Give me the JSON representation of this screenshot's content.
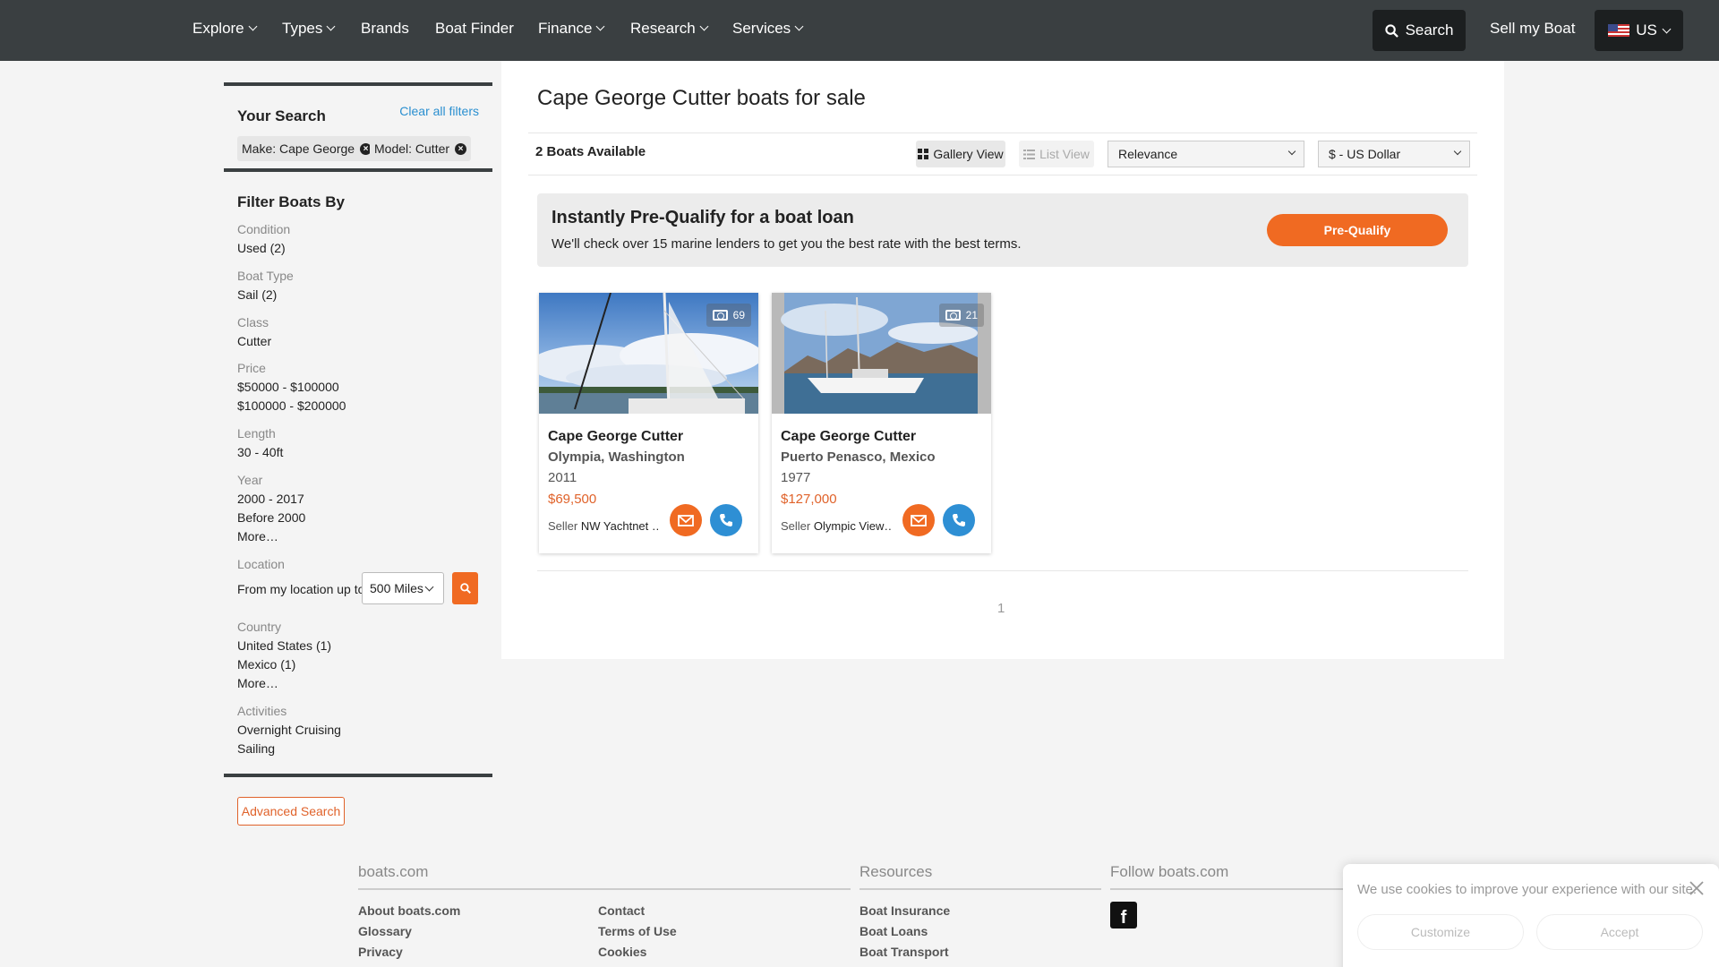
{
  "nav": {
    "items": [
      {
        "label": "Explore",
        "dropdown": true
      },
      {
        "label": "Types",
        "dropdown": true
      },
      {
        "label": "Brands",
        "dropdown": false
      },
      {
        "label": "Boat Finder",
        "dropdown": false
      },
      {
        "label": "Finance",
        "dropdown": true
      },
      {
        "label": "Research",
        "dropdown": true
      },
      {
        "label": "Services",
        "dropdown": true
      }
    ],
    "search_label": "Search",
    "sell_label": "Sell my Boat",
    "region_label": "US"
  },
  "your_search": {
    "title": "Your Search",
    "clear_label": "Clear all filters",
    "chips": [
      "Make: Cape George",
      "Model: Cutter"
    ]
  },
  "filters": {
    "title": "Filter Boats By",
    "condition_label": "Condition",
    "condition_values": [
      "Used (2)"
    ],
    "boat_type_label": "Boat Type",
    "boat_type_values": [
      "Sail (2)"
    ],
    "class_label": "Class",
    "class_values": [
      "Cutter"
    ],
    "price_label": "Price",
    "price_values": [
      "$50000 - $100000",
      "$100000 - $200000"
    ],
    "length_label": "Length",
    "length_values": [
      "30 - 40ft"
    ],
    "year_label": "Year",
    "year_values": [
      "2000 - 2017",
      "Before 2000",
      "More…"
    ],
    "location_label": "Location",
    "location_text": "From my location up to",
    "distance_value": "500 Miles",
    "country_label": "Country",
    "country_values": [
      "United States (1)",
      "Mexico (1)",
      "More…"
    ],
    "activities_label": "Activities",
    "activities_values": [
      "Overnight Cruising",
      "Sailing"
    ]
  },
  "advanced_search_label": "Advanced Search",
  "main": {
    "title": "Cape George Cutter boats for sale",
    "count": "2 Boats Available",
    "gallery_label": "Gallery View",
    "list_label": "List View",
    "sort_value": "Relevance",
    "currency_value": "$ - US Dollar"
  },
  "loan": {
    "title": "Instantly Pre-Qualify for a boat loan",
    "text": "We'll check over 15 marine lenders to get you the best rate with the best terms.",
    "button": "Pre-Qualify"
  },
  "listings": [
    {
      "photos": "69",
      "title": "Cape George Cutter",
      "location": "Olympia, Washington",
      "year": "2011",
      "price": "$69,500",
      "seller_label": "Seller",
      "seller": "NW Yachtnet …"
    },
    {
      "photos": "21",
      "title": "Cape George Cutter",
      "location": "Puerto Penasco, Mexico",
      "year": "1977",
      "price": "$127,000",
      "seller_label": "Seller",
      "seller": "Olympic View…"
    }
  ],
  "pagination": {
    "current": "1"
  },
  "footer": {
    "col1_title": "boats.com",
    "col1a_links": [
      "About boats.com",
      "Glossary",
      "Privacy"
    ],
    "col1b_links": [
      "Contact",
      "Terms of Use",
      "Cookies"
    ],
    "col2_title": "Resources",
    "col2_links": [
      "Boat Insurance",
      "Boat Loans",
      "Boat Transport"
    ],
    "col3_title": "Follow boats.com"
  },
  "cookie": {
    "text": "We use cookies to improve your experience with our site.",
    "customize": "Customize",
    "accept": "Accept"
  },
  "colors": {
    "accent": "#f06a22",
    "nav_bg": "#3a3f41",
    "call_button": "#2e8fd4",
    "link": "#2a8fd0"
  }
}
